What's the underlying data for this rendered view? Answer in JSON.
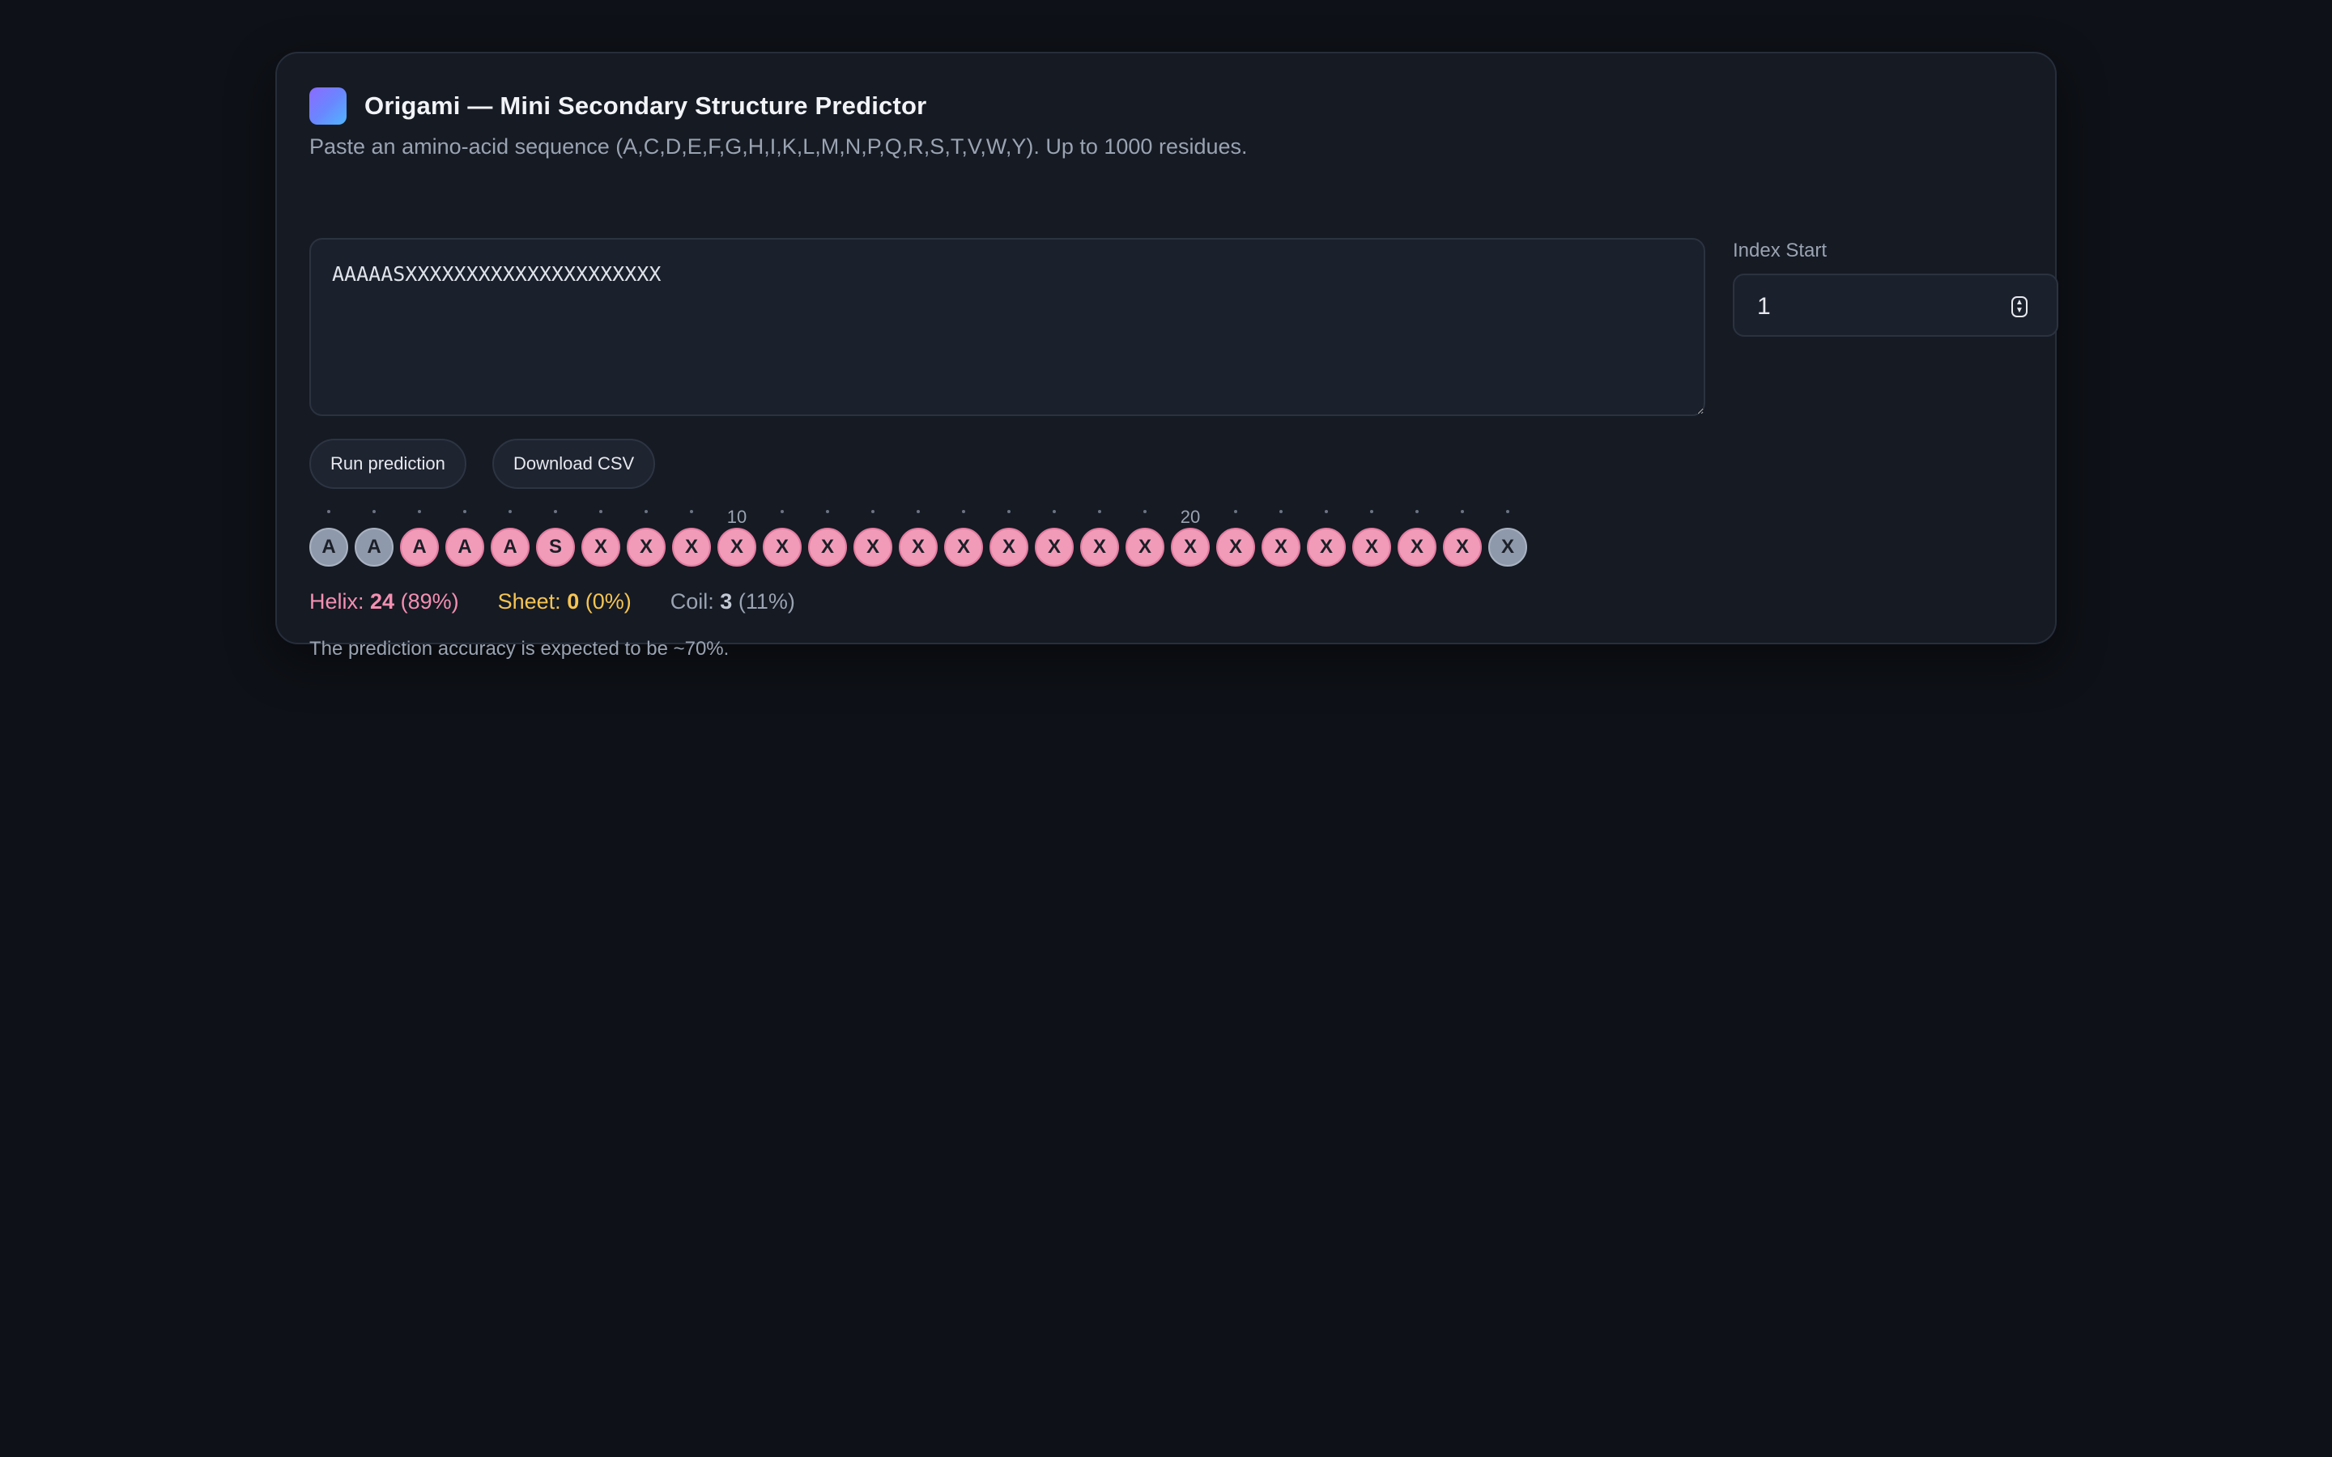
{
  "header": {
    "title": "Origami — Mini Secondary Structure Predictor",
    "subtitle": "Paste an amino-acid sequence (A,C,D,E,F,G,H,I,K,L,M,N,P,Q,R,S,T,V,W,Y). Up to 1000 residues."
  },
  "sequence": {
    "value": "AAAAASXXXXXXXXXXXXXXXXXXXXX"
  },
  "index_start": {
    "label": "Index Start",
    "value": "1"
  },
  "buttons": {
    "run": "Run prediction",
    "csv": "Download CSV"
  },
  "ticks": {
    "ten": "10",
    "twenty": "20"
  },
  "residues": [
    {
      "aa": "A",
      "ss": "C"
    },
    {
      "aa": "A",
      "ss": "C"
    },
    {
      "aa": "A",
      "ss": "H"
    },
    {
      "aa": "A",
      "ss": "H"
    },
    {
      "aa": "A",
      "ss": "H"
    },
    {
      "aa": "S",
      "ss": "H"
    },
    {
      "aa": "X",
      "ss": "H"
    },
    {
      "aa": "X",
      "ss": "H"
    },
    {
      "aa": "X",
      "ss": "H"
    },
    {
      "aa": "X",
      "ss": "H"
    },
    {
      "aa": "X",
      "ss": "H"
    },
    {
      "aa": "X",
      "ss": "H"
    },
    {
      "aa": "X",
      "ss": "H"
    },
    {
      "aa": "X",
      "ss": "H"
    },
    {
      "aa": "X",
      "ss": "H"
    },
    {
      "aa": "X",
      "ss": "H"
    },
    {
      "aa": "X",
      "ss": "H"
    },
    {
      "aa": "X",
      "ss": "H"
    },
    {
      "aa": "X",
      "ss": "H"
    },
    {
      "aa": "X",
      "ss": "H"
    },
    {
      "aa": "X",
      "ss": "H"
    },
    {
      "aa": "X",
      "ss": "H"
    },
    {
      "aa": "X",
      "ss": "H"
    },
    {
      "aa": "X",
      "ss": "H"
    },
    {
      "aa": "X",
      "ss": "H"
    },
    {
      "aa": "X",
      "ss": "H"
    },
    {
      "aa": "X",
      "ss": "C"
    }
  ],
  "stats": {
    "helix_label": "Helix:",
    "helix_count": "24",
    "helix_pct": "(89%)",
    "sheet_label": "Sheet:",
    "sheet_count": "0",
    "sheet_pct": "(0%)",
    "coil_label": "Coil:",
    "coil_count": "3",
    "coil_pct": "(11%)"
  },
  "note": "The prediction accuracy is expected to be ~70%.",
  "colors": {
    "helix": "#f48fb1",
    "sheet": "#f6c453",
    "coil": "#9aa3b2",
    "accent": "#6a86ff"
  }
}
